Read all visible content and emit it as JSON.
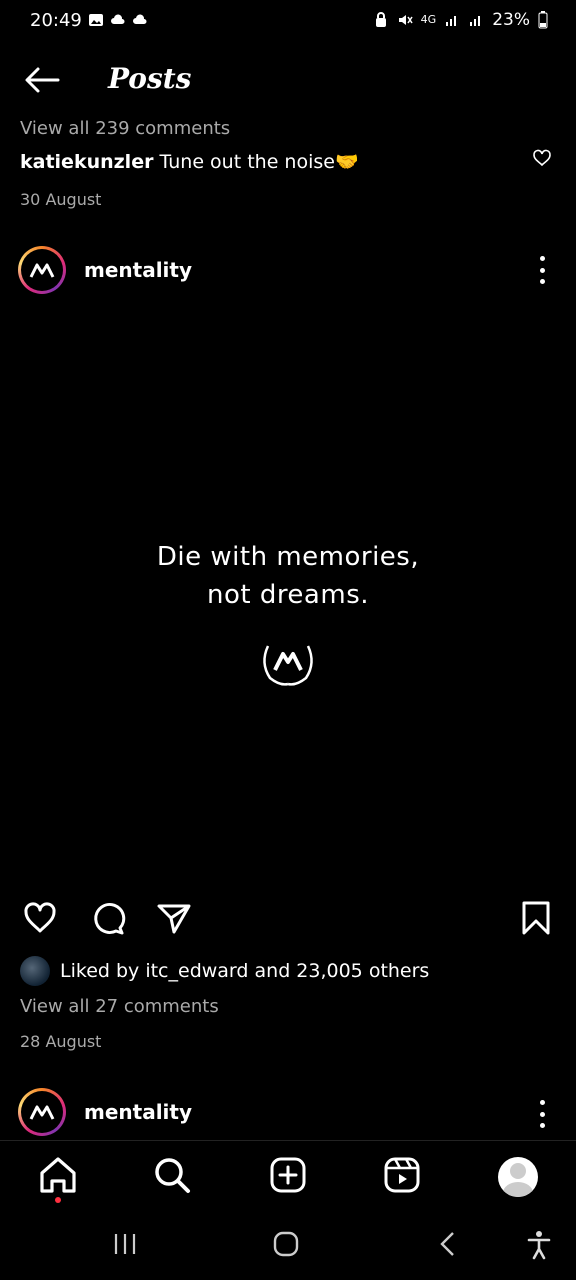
{
  "status_bar": {
    "time": "20:49",
    "network": "4G",
    "battery": "23%"
  },
  "header": {
    "title": "Posts"
  },
  "previous_post": {
    "view_all": "View all 239 comments",
    "username": "katiekunzler",
    "caption": "Tune out the noise🤝",
    "date": "30 August"
  },
  "post": {
    "username": "mentality",
    "quote_line1": "Die with memories,",
    "quote_line2": "not dreams.",
    "liked_by": "Liked by itc_edward and 23,005 others",
    "view_all": "View all 27 comments",
    "date": "28 August"
  },
  "next_post": {
    "username": "mentality"
  },
  "icons": {
    "back": "arrow-left-icon",
    "like": "heart-icon",
    "comment": "comment-icon",
    "share": "send-icon",
    "save": "bookmark-icon",
    "home": "home-icon",
    "search": "search-icon",
    "create": "plus-square-icon",
    "reels": "reels-icon",
    "profile": "profile-avatar-icon"
  },
  "colors": {
    "background": "#000000",
    "text": "#ffffff",
    "secondary_text": "#aaaaaa",
    "notification_dot": "#ff3040"
  }
}
